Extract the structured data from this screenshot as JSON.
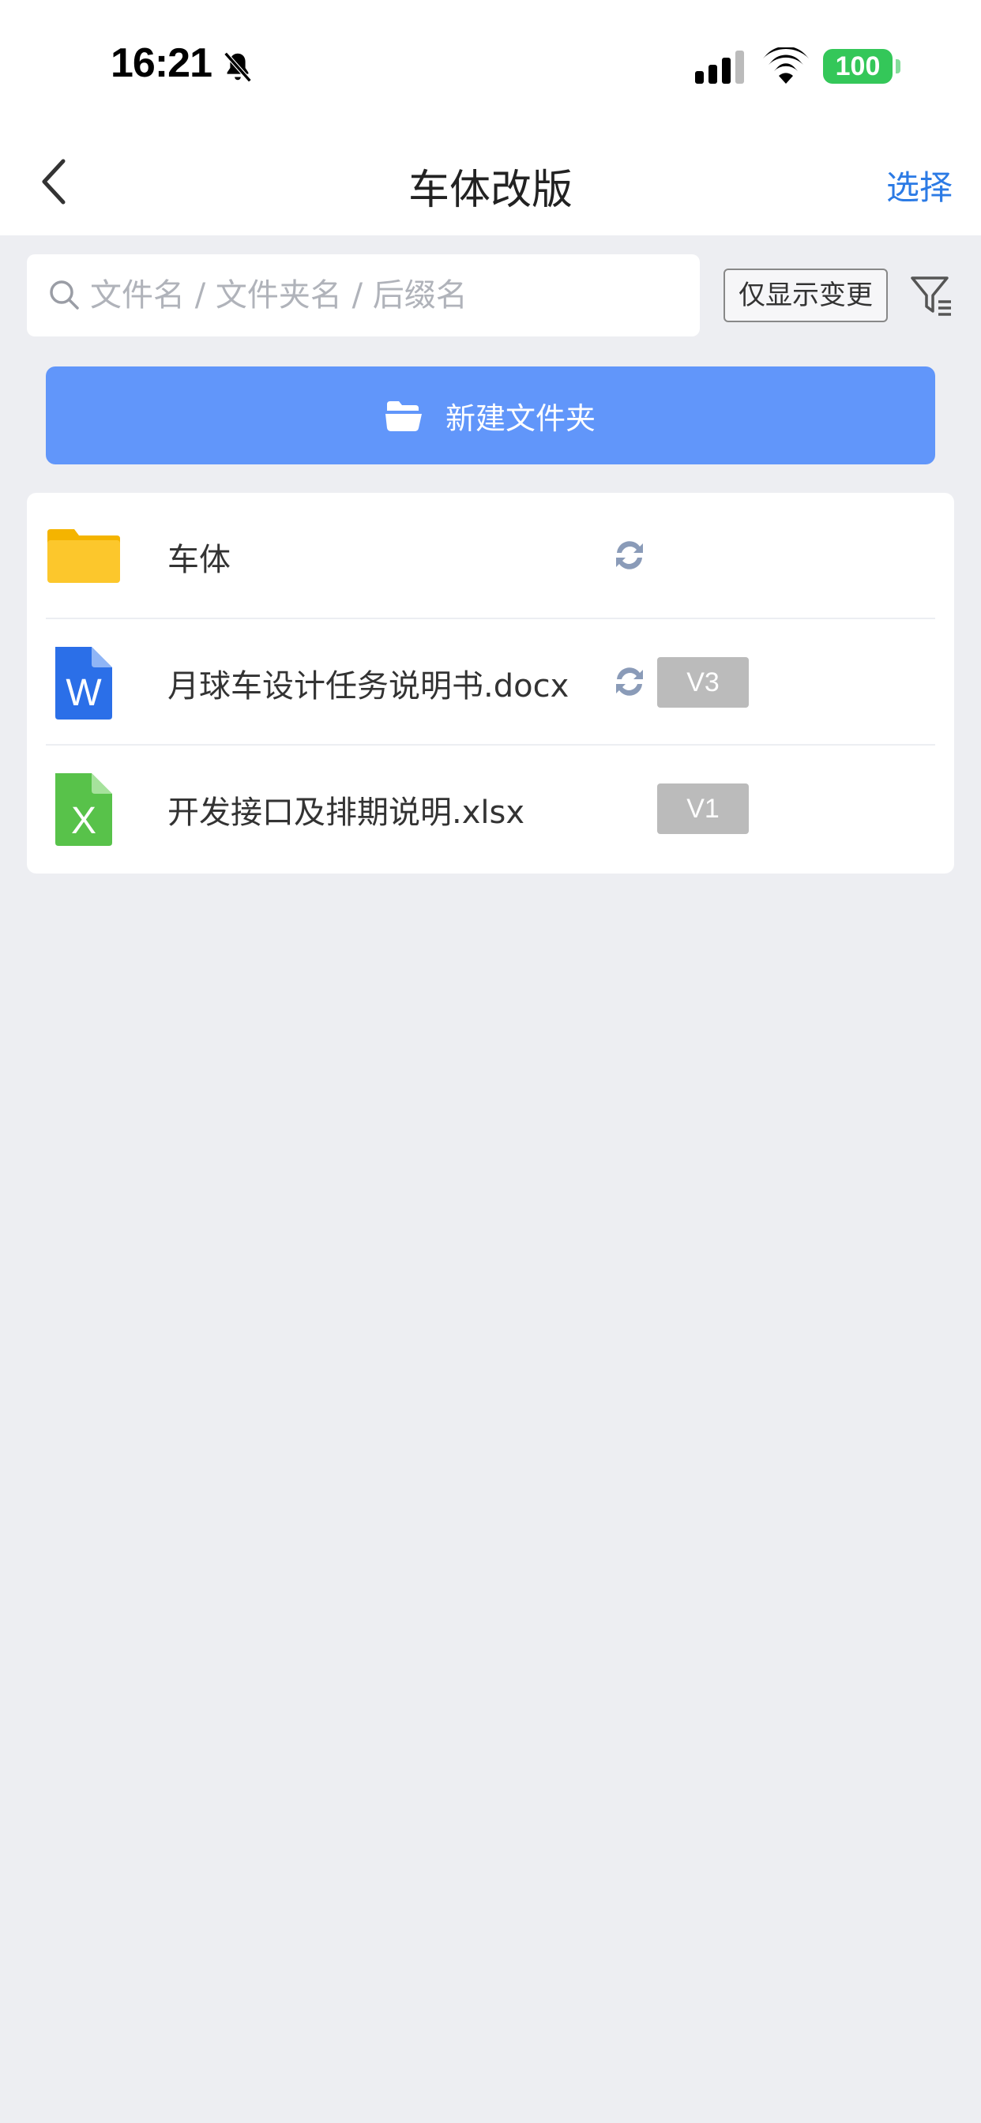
{
  "status_bar": {
    "time": "16:21",
    "battery": "100",
    "icons": [
      "bell-muted-icon",
      "cellular-signal-icon",
      "wifi-icon",
      "battery-icon"
    ]
  },
  "nav": {
    "title": "车体改版",
    "back_icon": "chevron-left-icon",
    "action_label": "选择"
  },
  "search": {
    "placeholder": "文件名 / 文件夹名 / 后缀名",
    "value": "",
    "icon": "search-icon"
  },
  "filter": {
    "changes_only_label": "仅显示变更",
    "filter_icon": "filter-list-icon"
  },
  "new_folder": {
    "label": "新建文件夹",
    "icon": "folder-open-icon"
  },
  "files": [
    {
      "name": "车体",
      "type": "folder",
      "icon": "folder-icon",
      "synced": true,
      "version": ""
    },
    {
      "name": "月球车设计任务说明书.docx",
      "type": "word",
      "icon": "word-doc-icon",
      "synced": true,
      "version": "V3"
    },
    {
      "name": "开发接口及排期说明.xlsx",
      "type": "excel",
      "icon": "excel-sheet-icon",
      "synced": false,
      "version": "V1"
    }
  ],
  "colors": {
    "accent": "#2c7be5",
    "primary_button": "#6196fa",
    "background": "#edeef2",
    "folder": "#fcc72c",
    "word": "#2b6fe8",
    "excel": "#58c24a",
    "sync": "#8a9bb8",
    "badge": "#bbbbbb"
  }
}
